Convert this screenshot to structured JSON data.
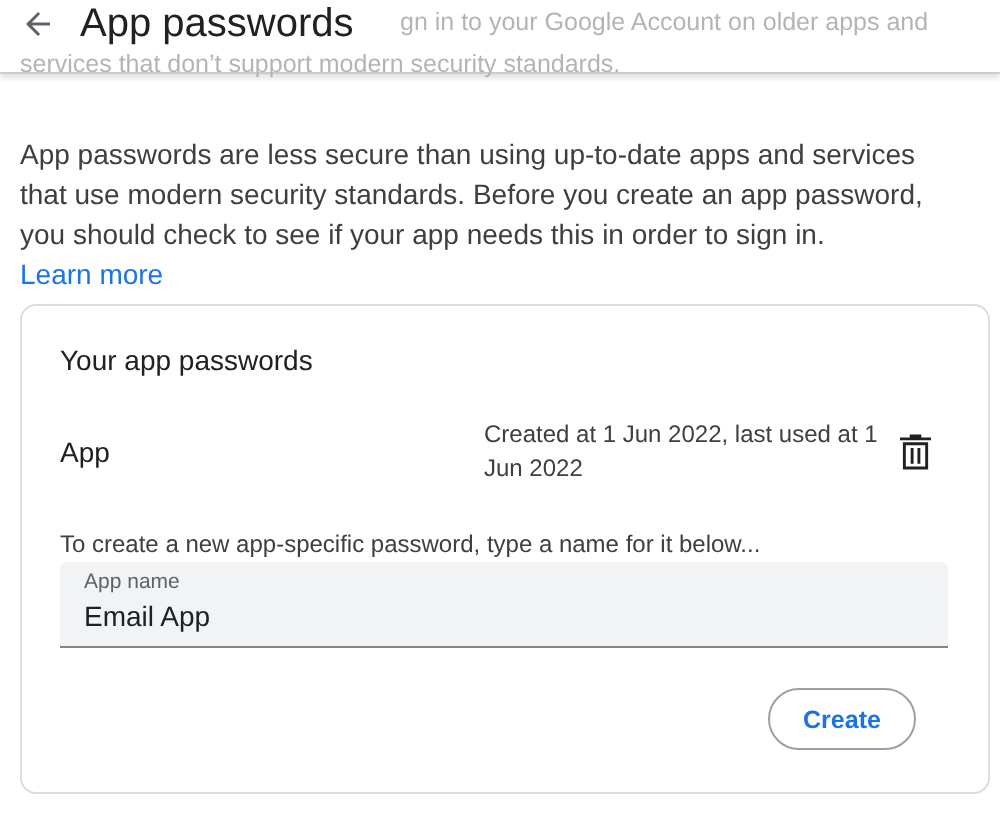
{
  "header": {
    "title": "App passwords",
    "behind_lines": [
      "gn in to your Google Account on older apps and",
      "services that don’t support modern security standards."
    ]
  },
  "intro": {
    "text": "App passwords are less secure than using up-to-date apps and services that use modern security standards. Before you create an app password, you should check to see if your app needs this in order to sign in.",
    "link": "Learn more"
  },
  "card": {
    "heading": "Your app passwords",
    "passwords": [
      {
        "name": "App",
        "meta": "Created at 1 Jun 2022, last used at 1 Jun 2022"
      }
    ],
    "instruction": "To create a new app-specific password, type a name for it below...",
    "field": {
      "label": "App name",
      "value": "Email App"
    },
    "button": "Create"
  }
}
